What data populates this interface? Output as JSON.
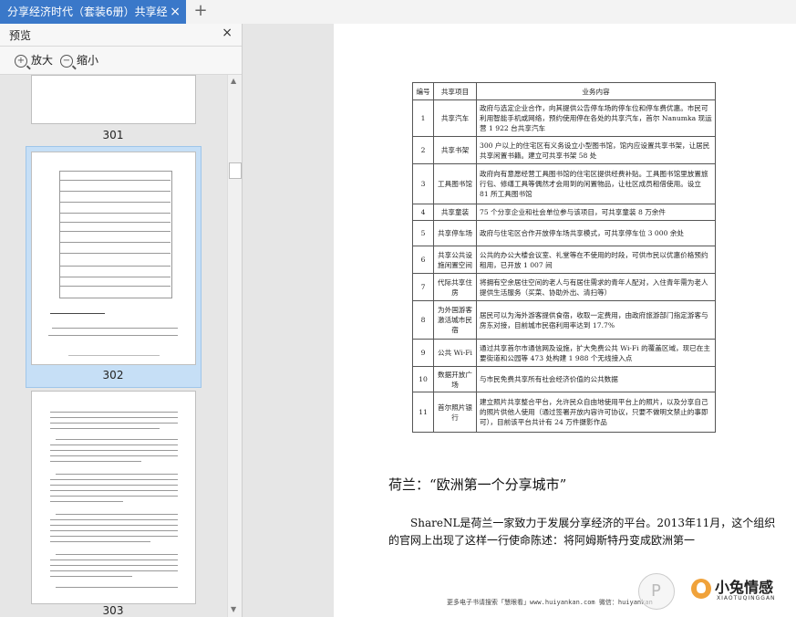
{
  "tab": {
    "title": "分享经济时代（套装6册）共享经",
    "close": "×",
    "add": "+"
  },
  "panel": {
    "title": "预览",
    "close": "×",
    "zoom_in": "放大",
    "zoom_out": "缩小"
  },
  "thumbnails": [
    {
      "page": "301"
    },
    {
      "page": "302",
      "selected": true
    },
    {
      "page": "303"
    }
  ],
  "table": {
    "headers": [
      "编号",
      "共享项目",
      "业务内容"
    ],
    "rows": [
      [
        "1",
        "共享汽车",
        "政府与选定企业合作，向其提供公告停车场的停车位和停车费优惠。市民可利用智能手机或网络，预约使用停在各处的共享汽车，首尔 Nanumka 现运营 1 922 台共享汽车"
      ],
      [
        "2",
        "共享书架",
        "300 户以上的住宅区有义务设立小型图书馆，馆内应设置共享书架，让居民共享闲置书籍。建立可共享书架 58 处"
      ],
      [
        "3",
        "工具图书馆",
        "政府向有意愿经营工具图书馆的住宅区提供经费补贴。工具图书馆里放置旅行包、修缮工具等偶然才会用到的闲置物品，让社区成员租借使用。设立 81 所工具图书馆"
      ],
      [
        "4",
        "共享童装",
        "75 个分享企业和社会单位参与该项目，可共享童装 8 万余件"
      ],
      [
        "5",
        "共享停车场",
        "政府与住宅区合作开放停车场共享模式，可共享停车位 3 000 余处"
      ],
      [
        "6",
        "共享公共设施闲置空间",
        "公共的办公大楼会议室、礼堂等在不使用的时段，可供市民以优惠价格预约租用，已开放 1 007 间"
      ],
      [
        "7",
        "代际共享住房",
        "将拥有空余居住空间的老人与有居住需求的青年人配对，入住青年需为老人提供生活服务（买菜、协助外出、清扫等）"
      ],
      [
        "8",
        "为外国游客激活城市民宿",
        "居民可以为海外游客提供食宿，收取一定费用，由政府旅游部门指定游客与房东对接，目前城市民宿利用率达到 17.7%"
      ],
      [
        "9",
        "公共 Wi-Fi",
        "通过共享首尔市通信网及设施，扩大免费公共 Wi-Fi 的覆盖区域，现已在主要街道和公园等 473 处构建 1 988 个无线接入点"
      ],
      [
        "10",
        "数据开放广场",
        "与市民免费共享所有社会经济价值的公共数据"
      ],
      [
        "11",
        "首尔照片银行",
        "建立照片共享整合平台，允许民众自由地使用平台上的照片，以及分享自己的照片供他人使用（通过签署开放内容许可协议，只要不做明文禁止的事即可），目前该平台共计有 24 万件摄影作品"
      ]
    ]
  },
  "section": {
    "title": "荷兰：“欧洲第一个分享城市”",
    "paragraph": "ShareNL是荷兰一家致力于发展分享经济的平台。2013年11月，这个组织的官网上出现了这样一行使命陈述：将阿姆斯特丹变成欧洲第一"
  },
  "footer": "更多电子书请搜索「慧眼看」www.huiyankan.com  微信：huiyankan",
  "watermark": {
    "brand": "小兔情感",
    "sub": "XIAOTUQINGGAN"
  }
}
